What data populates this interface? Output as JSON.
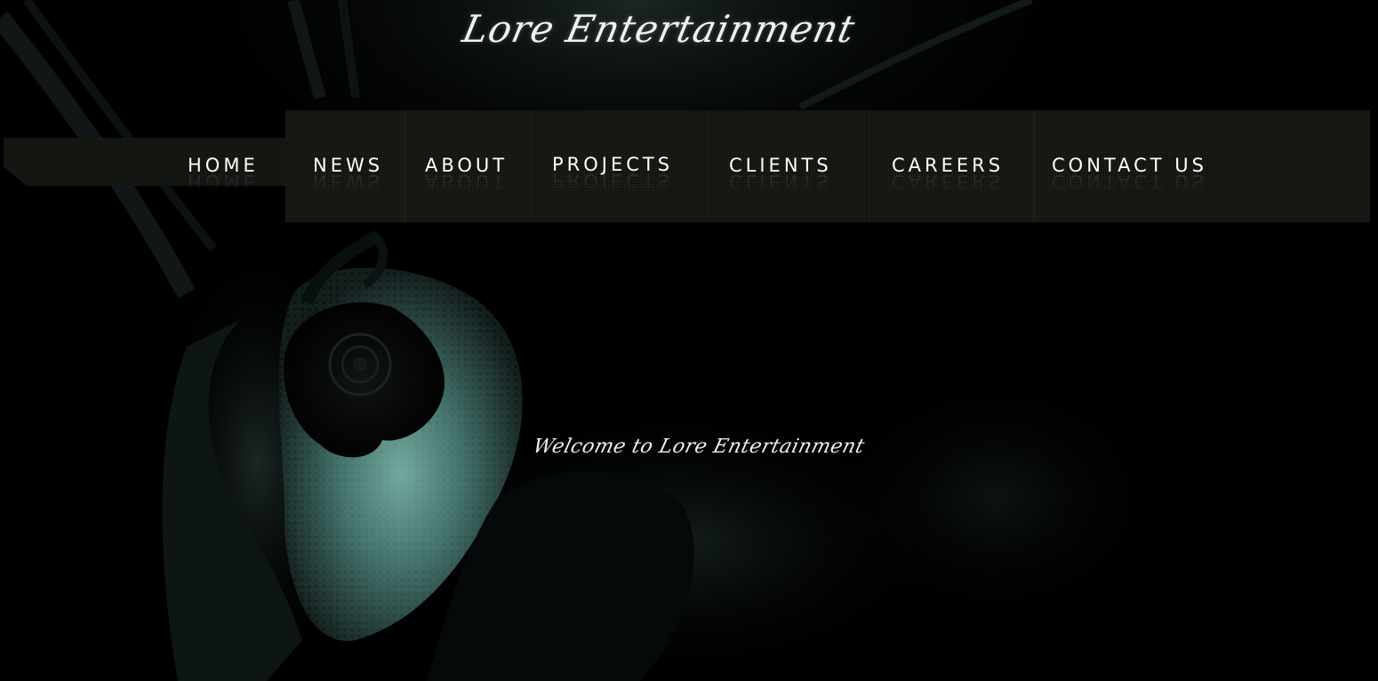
{
  "brand": {
    "logo_text": "Lore Entertainment"
  },
  "nav": {
    "items": [
      {
        "id": "home",
        "label": "HOME"
      },
      {
        "id": "news",
        "label": "NEWS"
      },
      {
        "id": "about",
        "label": "ABOUT"
      },
      {
        "id": "projects",
        "label": "PROJECTS"
      },
      {
        "id": "clients",
        "label": "CLIENTS"
      },
      {
        "id": "careers",
        "label": "CAREERS"
      },
      {
        "id": "contact",
        "label": "CONTACT US"
      }
    ]
  },
  "hero": {
    "welcome_text": "Welcome to Lore Entertainment"
  },
  "colors": {
    "background": "#000000",
    "nav_panel": "#121410",
    "text": "#ffffff",
    "hero_tint": "#5f9a90"
  }
}
